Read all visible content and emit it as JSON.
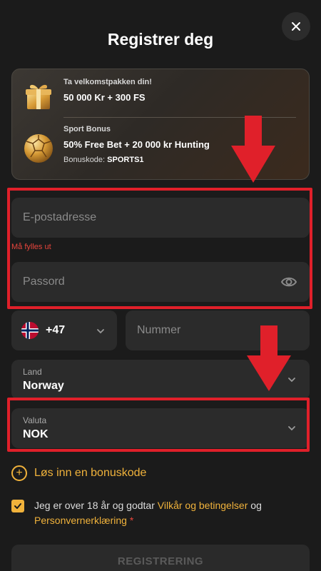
{
  "header": {
    "title": "Registrer deg",
    "close_icon": "close-icon"
  },
  "promo": {
    "welcome_title": "Ta velkomstpakken din!",
    "welcome_offer": "50 000 Kr + 300 FS",
    "sport_title": "Sport Bonus",
    "sport_offer": "50% Free Bet + 20 000 kr Hunting",
    "bonus_code_label": "Bonuskode:",
    "bonus_code_value": "SPORTS1"
  },
  "form": {
    "email_placeholder": "E-postadresse",
    "email_error": "Må fylles ut",
    "password_placeholder": "Passord",
    "phone_prefix": "+47",
    "phone_flag": "norway-flag",
    "phone_placeholder": "Nummer",
    "country_label": "Land",
    "country_value": "Norway",
    "currency_label": "Valuta",
    "currency_value": "NOK"
  },
  "bonus_link": "Løs inn en bonuskode",
  "consent": {
    "checked": true,
    "text_before": "Jeg er over 18 år og godtar ",
    "terms_link": "Vilkår og betingelser",
    "text_and": " og ",
    "privacy_link": "Personvernerklæring",
    "required_mark": " *"
  },
  "submit_label": "REGISTRERING",
  "colors": {
    "background": "#1b1b1b",
    "field": "#2b2b2b",
    "accent": "#f0b23b",
    "annotation": "#e0202a",
    "error": "#e8453c"
  }
}
